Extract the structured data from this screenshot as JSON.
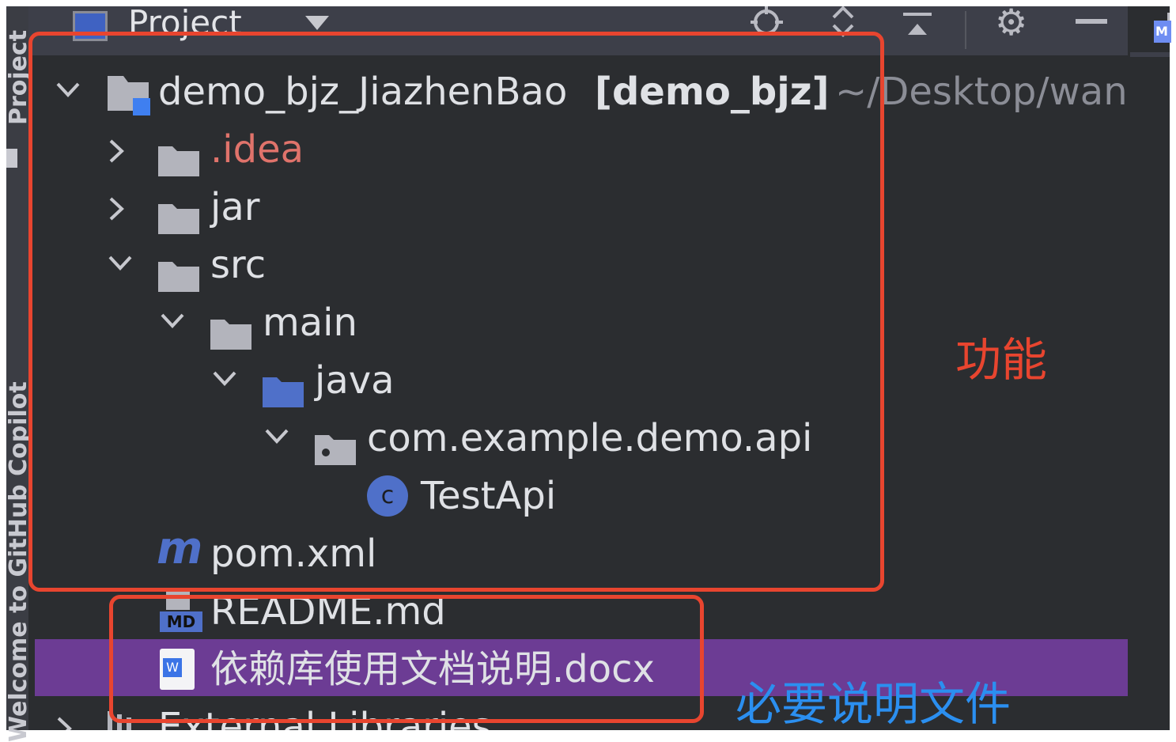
{
  "left_toolstrip": {
    "top_label": "Project",
    "bottom_label": "Welcome to GitHub Copilot"
  },
  "header": {
    "title": "Project",
    "icons": [
      "locate-icon",
      "expand-all-icon",
      "collapse-all-icon",
      "gear-icon",
      "minimize-icon"
    ]
  },
  "tree": {
    "root": {
      "name": "demo_bjz_JiazhenBao",
      "module": "[demo_bjz]",
      "path": "~/Desktop/wang"
    },
    "items": [
      {
        "label": ".idea",
        "expanded": false
      },
      {
        "label": "jar",
        "expanded": false
      },
      {
        "label": "src",
        "expanded": true
      },
      {
        "label": "main",
        "expanded": true
      },
      {
        "label": "java",
        "expanded": true
      },
      {
        "label": "com.example.demo.api",
        "expanded": true
      },
      {
        "label": "TestApi",
        "icon_letter": "c"
      },
      {
        "label": "pom.xml",
        "icon_letter": "m"
      },
      {
        "label": "README.md",
        "icon_letter": "MD"
      },
      {
        "label": "依赖库使用文档说明.docx",
        "icon_letter": "W"
      },
      {
        "label": "External Libraries",
        "expanded": false
      }
    ]
  },
  "right_strip": {
    "badge": "M"
  },
  "annotations": {
    "functions_label": "功能",
    "required_docs_label": "必要说明文件"
  },
  "colors": {
    "background": "#2b2d30",
    "header": "#3d3f49",
    "selection": "#6c3c94",
    "excluded_folder_text": "#e0736b",
    "source_folder": "#4f70c9",
    "annotation_red": "#e8452f",
    "annotation_blue": "#2b8ff0"
  }
}
